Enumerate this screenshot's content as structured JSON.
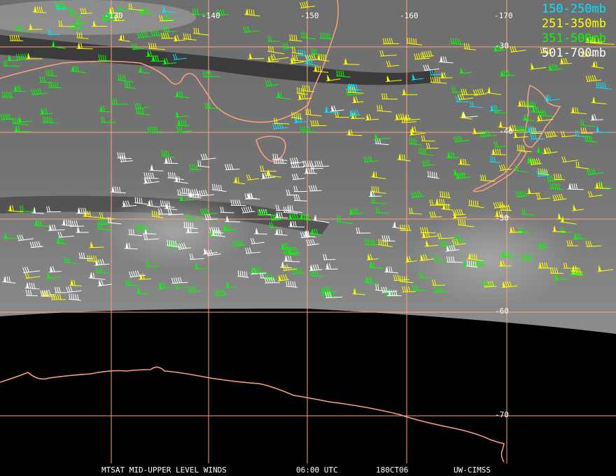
{
  "legend": {
    "items": [
      {
        "label": "150-250mb",
        "color": "#00e5ff"
      },
      {
        "label": "251-350mb",
        "color": "#ffff00"
      },
      {
        "label": "351-500mb",
        "color": "#00ff00"
      },
      {
        "label": "501-700mb",
        "color": "#ffffff"
      }
    ]
  },
  "longitude_labels": [
    "-130",
    "-140",
    "-150",
    "-160",
    "-170"
  ],
  "latitude_labels": [
    "-30",
    "-40",
    "-50",
    "-60",
    "-70"
  ],
  "footer": {
    "product": "MTSAT MID-UPPER LEVEL WINDS",
    "time": "06:00 UTC",
    "date": "180CT06",
    "source": "UW-CIMSS"
  },
  "colors": {
    "gridline": "#ff9f80",
    "coastline": "#ff9f80",
    "space": "#000000",
    "cloud": "#7a7a7a"
  }
}
